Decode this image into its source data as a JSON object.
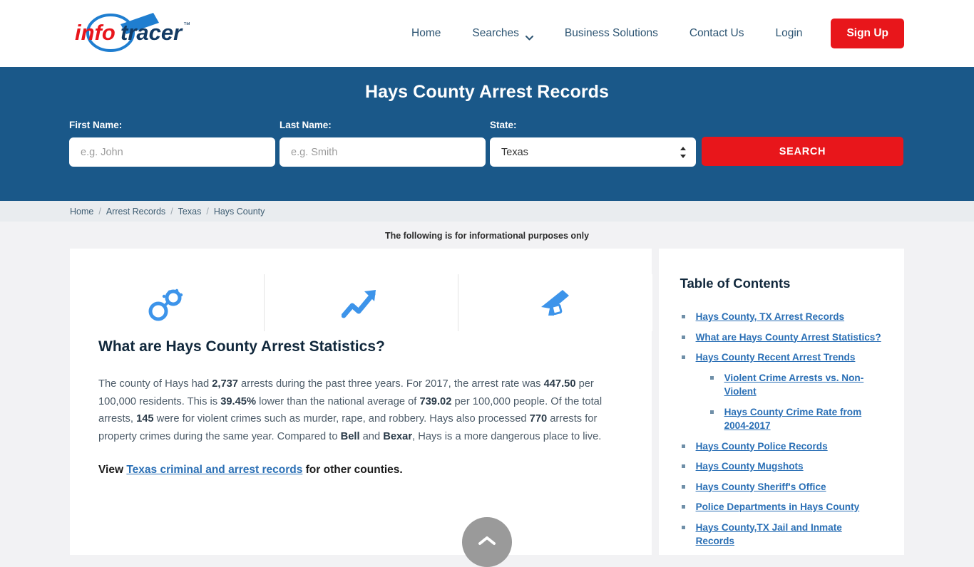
{
  "header": {
    "logo_text_1": "info",
    "logo_text_2": "tracer",
    "logo_tm": "™",
    "nav": [
      {
        "label": "Home",
        "has_chevron": false
      },
      {
        "label": "Searches",
        "has_chevron": true
      },
      {
        "label": "Business Solutions",
        "has_chevron": false
      },
      {
        "label": "Contact Us",
        "has_chevron": false
      },
      {
        "label": "Login",
        "has_chevron": false
      }
    ],
    "signup_label": "Sign Up",
    "signup_color": "#e8161b"
  },
  "banner": {
    "title": "Hays County Arrest Records",
    "background_color": "#1a5889",
    "first_name_label": "First Name:",
    "first_name_placeholder": "e.g. John",
    "first_name_value": "",
    "last_name_label": "Last Name:",
    "last_name_placeholder": "e.g. Smith",
    "last_name_value": "",
    "state_label": "State:",
    "state_value": "Texas",
    "search_label": "SEARCH"
  },
  "breadcrumb": {
    "items": [
      "Home",
      "Arrest Records",
      "Texas",
      "Hays County"
    ],
    "separator": "/"
  },
  "disclaimer": "The following is for informational purposes only",
  "main": {
    "title_highlight": "Hays",
    "title_rest": " County, TX Arrest Records",
    "title_accent_color": "#1f8ad6",
    "subheading": "What are Hays County Arrest Statistics?",
    "paragraph": {
      "p1": "The county of Hays had ",
      "b1": "2,737",
      "p2": " arrests during the past three years. For 2017, the arrest rate was ",
      "b2": "447.50",
      "p3": " per 100,000 residents. This is ",
      "b3": "39.45%",
      "p4": " lower than the national average of ",
      "b4": "739.02",
      "p5": " per 100,000 people. Of the total arrests, ",
      "b5": "145",
      "p6": " were for violent crimes such as murder, rape, and robbery. Hays also processed ",
      "b6": "770",
      "p7": " arrests for property crimes during the same year. Compared to ",
      "b7": "Bell",
      "p8": " and ",
      "b8": "Bexar",
      "p9": ", Hays is a more dangerous place to live."
    },
    "view_prefix": "View ",
    "view_link": "Texas criminal and arrest records",
    "view_suffix": " for other counties.",
    "icons": [
      "handcuffs-icon",
      "trending-up-chart-icon",
      "gun-icon"
    ]
  },
  "sidebar": {
    "toc_title": "Table of Contents",
    "items": [
      {
        "label": "Hays County, TX Arrest Records",
        "children": []
      },
      {
        "label": "What are Hays County Arrest Statistics?",
        "children": []
      },
      {
        "label": "Hays County Recent Arrest Trends",
        "children": [
          {
            "label": "Violent Crime Arrests vs. Non-Violent"
          },
          {
            "label": "Hays County Crime Rate from 2004-2017"
          }
        ]
      },
      {
        "label": "Hays County Police Records",
        "children": []
      },
      {
        "label": "Hays County Mugshots",
        "children": []
      },
      {
        "label": "Hays County Sheriff's Office",
        "children": []
      },
      {
        "label": "Police Departments in Hays County",
        "children": []
      },
      {
        "label": "Hays County,TX Jail and Inmate Records",
        "children": []
      }
    ],
    "link_color": "#2a6fb5"
  },
  "scroll_top": {
    "name": "scroll-to-top-button"
  }
}
